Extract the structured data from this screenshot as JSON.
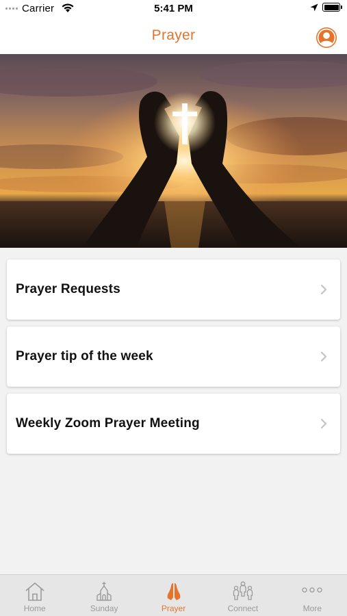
{
  "status_bar": {
    "carrier": "Carrier",
    "time": "5:41 PM"
  },
  "nav": {
    "title": "Prayer"
  },
  "menu_items": [
    {
      "label": "Prayer Requests"
    },
    {
      "label": "Prayer tip of the week"
    },
    {
      "label": "Weekly Zoom Prayer Meeting"
    }
  ],
  "tabs": [
    {
      "label": "Home",
      "icon": "house-icon",
      "active": false
    },
    {
      "label": "Sunday",
      "icon": "church-icon",
      "active": false
    },
    {
      "label": "Prayer",
      "icon": "praying-hands-icon",
      "active": true
    },
    {
      "label": "Connect",
      "icon": "people-icon",
      "active": false
    },
    {
      "label": "More",
      "icon": "more-dots-icon",
      "active": false
    }
  ],
  "colors": {
    "accent": "#e4742c",
    "tab_inactive": "#9a9a9a",
    "background": "#f2f2f2"
  }
}
